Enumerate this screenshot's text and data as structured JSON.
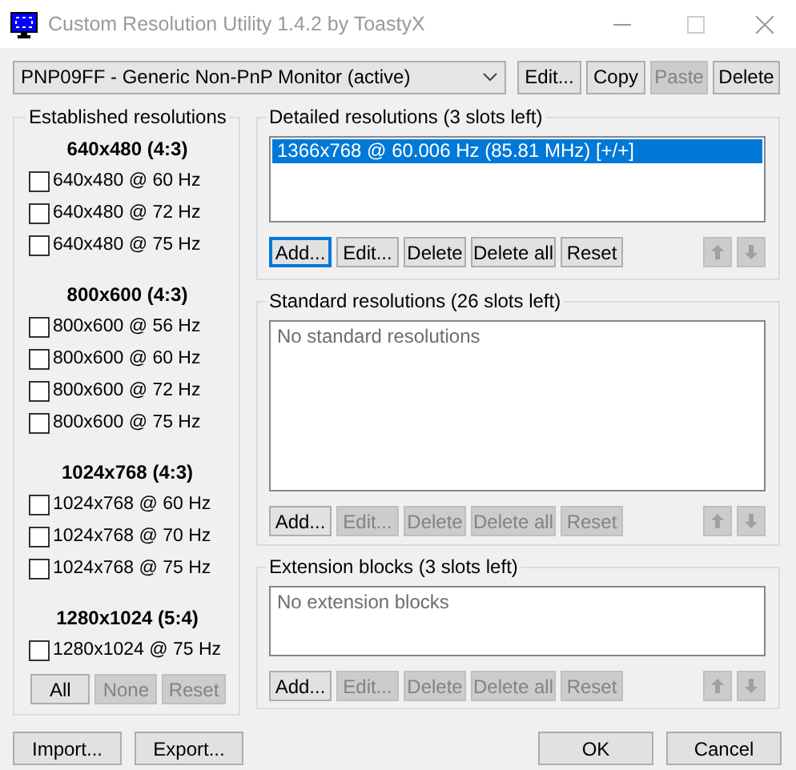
{
  "window": {
    "title": "Custom Resolution Utility 1.4.2 by ToastyX"
  },
  "monitor": {
    "value": "PNP09FF - Generic Non-PnP Monitor (active)"
  },
  "monitor_buttons": [
    {
      "label": "Edit...",
      "disabled": false
    },
    {
      "label": "Copy",
      "disabled": false
    },
    {
      "label": "Paste",
      "disabled": true
    },
    {
      "label": "Delete",
      "disabled": false
    }
  ],
  "established": {
    "title": "Established resolutions",
    "sections": [
      {
        "heading": "640x480 (4:3)",
        "items": [
          {
            "label": "640x480 @ 60 Hz",
            "checked": false
          },
          {
            "label": "640x480 @ 72 Hz",
            "checked": false
          },
          {
            "label": "640x480 @ 75 Hz",
            "checked": false
          }
        ]
      },
      {
        "heading": "800x600 (4:3)",
        "items": [
          {
            "label": "800x600 @ 56 Hz",
            "checked": false
          },
          {
            "label": "800x600 @ 60 Hz",
            "checked": false
          },
          {
            "label": "800x600 @ 72 Hz",
            "checked": false
          },
          {
            "label": "800x600 @ 75 Hz",
            "checked": false
          }
        ]
      },
      {
        "heading": "1024x768 (4:3)",
        "items": [
          {
            "label": "1024x768 @ 60 Hz",
            "checked": false
          },
          {
            "label": "1024x768 @ 70 Hz",
            "checked": false
          },
          {
            "label": "1024x768 @ 75 Hz",
            "checked": false
          }
        ]
      },
      {
        "heading": "1280x1024 (5:4)",
        "items": [
          {
            "label": "1280x1024 @ 75 Hz",
            "checked": false
          }
        ]
      }
    ],
    "buttons": [
      {
        "label": "All",
        "disabled": false
      },
      {
        "label": "None",
        "disabled": true
      },
      {
        "label": "Reset",
        "disabled": true
      }
    ]
  },
  "groups": [
    {
      "title": "Detailed resolutions (3 slots left)",
      "items": [
        {
          "label": "1366x768 @ 60.006 Hz (85.81 MHz) [+/+]",
          "selected": true
        }
      ],
      "buttons": [
        {
          "label": "Add...",
          "disabled": false,
          "focused": true
        },
        {
          "label": "Edit...",
          "disabled": false,
          "focused": false
        },
        {
          "label": "Delete",
          "disabled": false,
          "focused": false
        },
        {
          "label": "Delete all",
          "disabled": false,
          "focused": false
        },
        {
          "label": "Reset",
          "disabled": false,
          "focused": false
        }
      ],
      "move_up": {
        "disabled": true
      },
      "move_down": {
        "disabled": true
      }
    },
    {
      "title": "Standard resolutions (26 slots left)",
      "empty_text": "No standard resolutions",
      "buttons": [
        {
          "label": "Add...",
          "disabled": false,
          "focused": false
        },
        {
          "label": "Edit...",
          "disabled": true,
          "focused": false
        },
        {
          "label": "Delete",
          "disabled": true,
          "focused": false
        },
        {
          "label": "Delete all",
          "disabled": true,
          "focused": false
        },
        {
          "label": "Reset",
          "disabled": true,
          "focused": false
        }
      ],
      "move_up": {
        "disabled": true
      },
      "move_down": {
        "disabled": true
      }
    },
    {
      "title": "Extension blocks (3 slots left)",
      "empty_text": "No extension blocks",
      "buttons": [
        {
          "label": "Add...",
          "disabled": false,
          "focused": false
        },
        {
          "label": "Edit...",
          "disabled": true,
          "focused": false
        },
        {
          "label": "Delete",
          "disabled": true,
          "focused": false
        },
        {
          "label": "Delete all",
          "disabled": true,
          "focused": false
        },
        {
          "label": "Reset",
          "disabled": true,
          "focused": false
        }
      ],
      "move_up": {
        "disabled": true
      },
      "move_down": {
        "disabled": true
      }
    }
  ],
  "footer": {
    "left": [
      {
        "label": "Import..."
      },
      {
        "label": "Export..."
      }
    ],
    "right": [
      {
        "label": "OK"
      },
      {
        "label": "Cancel"
      }
    ]
  }
}
